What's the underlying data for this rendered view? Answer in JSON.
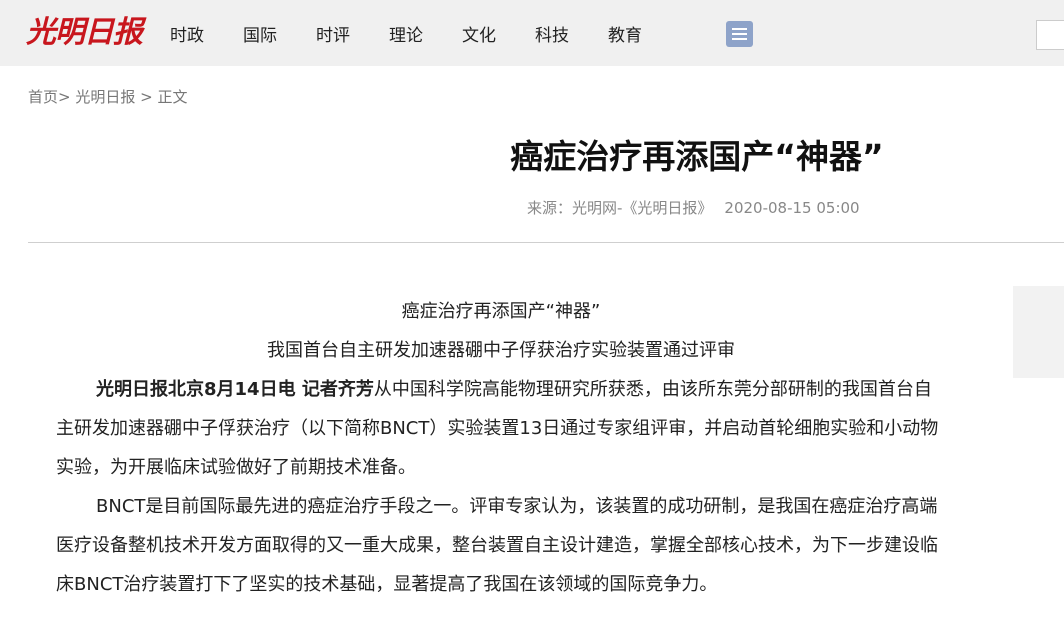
{
  "header": {
    "logo_text": "光明日报",
    "nav_items": [
      "时政",
      "国际",
      "时评",
      "理论",
      "文化",
      "科技",
      "教育"
    ],
    "menu_icon": "list-menu-icon"
  },
  "breadcrumb": {
    "home": "首页",
    "sep1": ">",
    "section": "光明日报",
    "sep2": ">",
    "current": "正文"
  },
  "article": {
    "title": "癌症治疗再添国产“神器”",
    "source": "来源：光明网-《光明日报》",
    "date": "2020-08-15 05:00",
    "headline": "癌症治疗再添国产“神器”",
    "subheadline": "我国首台自主研发加速器硼中子俘获治疗实验装置通过评审",
    "lead_bold": "光明日报北京8月14日电 记者齐芳",
    "lead_rest": "从中国科学院高能物理研究所获悉，由该所东莞分部研制的我国首台自主研发加速器硼中子俘获治疗（以下简称BNCT）实验装置13日通过专家组评审，并启动首轮细胞实验和小动物实验，为开展临床试验做好了前期技术准备。",
    "paragraph2": "BNCT是目前国际最先进的癌症治疗手段之一。评审专家认为，该装置的成功研制，是我国在癌症治疗高端医疗设备整机技术开发方面取得的又一重大成果，整台装置自主设计建造，掌握全部核心技术，为下一步建设临床BNCT治疗装置打下了坚实的技术基础，显著提高了我国在该领域的国际竞争力。"
  }
}
